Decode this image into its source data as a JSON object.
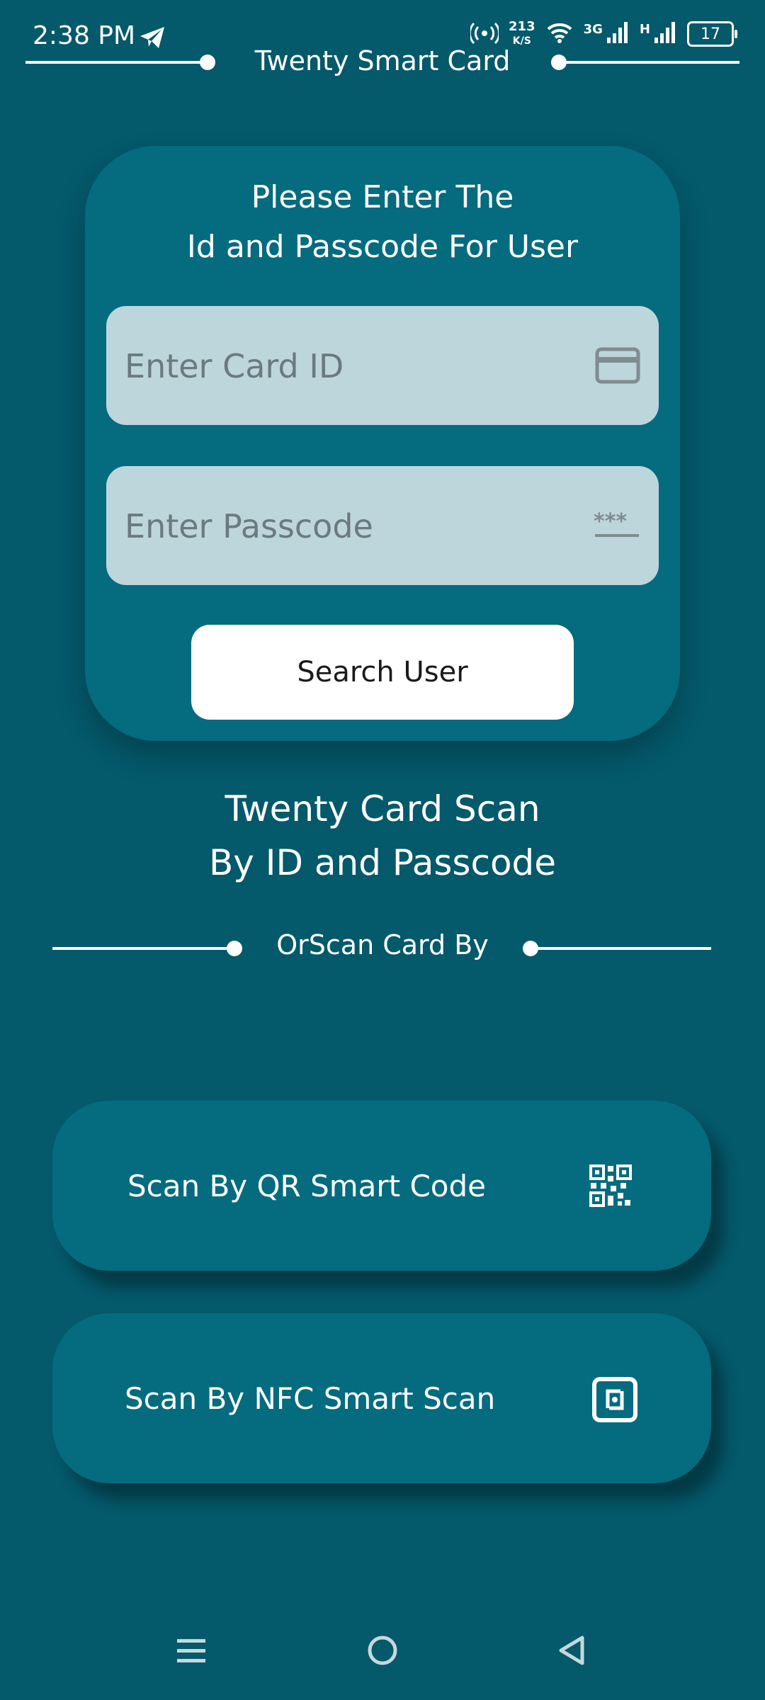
{
  "status_bar": {
    "time": "2:38 PM",
    "net_speed_value": "213",
    "net_speed_unit": "K/S",
    "network_3g": "3G",
    "network_h": "H",
    "battery": "17"
  },
  "header": {
    "title": "Twenty Smart Card"
  },
  "login_card": {
    "prompt_line1": "Please Enter The",
    "prompt_line2": "Id and Passcode For User",
    "card_id_placeholder": "Enter Card ID",
    "passcode_placeholder": "Enter Passcode",
    "search_button": "Search User"
  },
  "scan_section": {
    "title_line1": "Twenty Card Scan",
    "title_line2": "By ID and Passcode",
    "divider_text": "OrScan Card By",
    "qr_button": "Scan By QR Smart Code",
    "nfc_button": "Scan By NFC Smart Scan"
  },
  "icons": {
    "card_field": "credit-card-icon",
    "passcode_field": "password-icon",
    "qr": "qr-code-icon",
    "nfc": "nfc-icon",
    "nav_menu": "menu-icon",
    "nav_home": "home-icon",
    "nav_back": "back-icon"
  },
  "colors": {
    "background": "#04596b",
    "card": "#056b7f",
    "field": "#bdd6dc"
  }
}
